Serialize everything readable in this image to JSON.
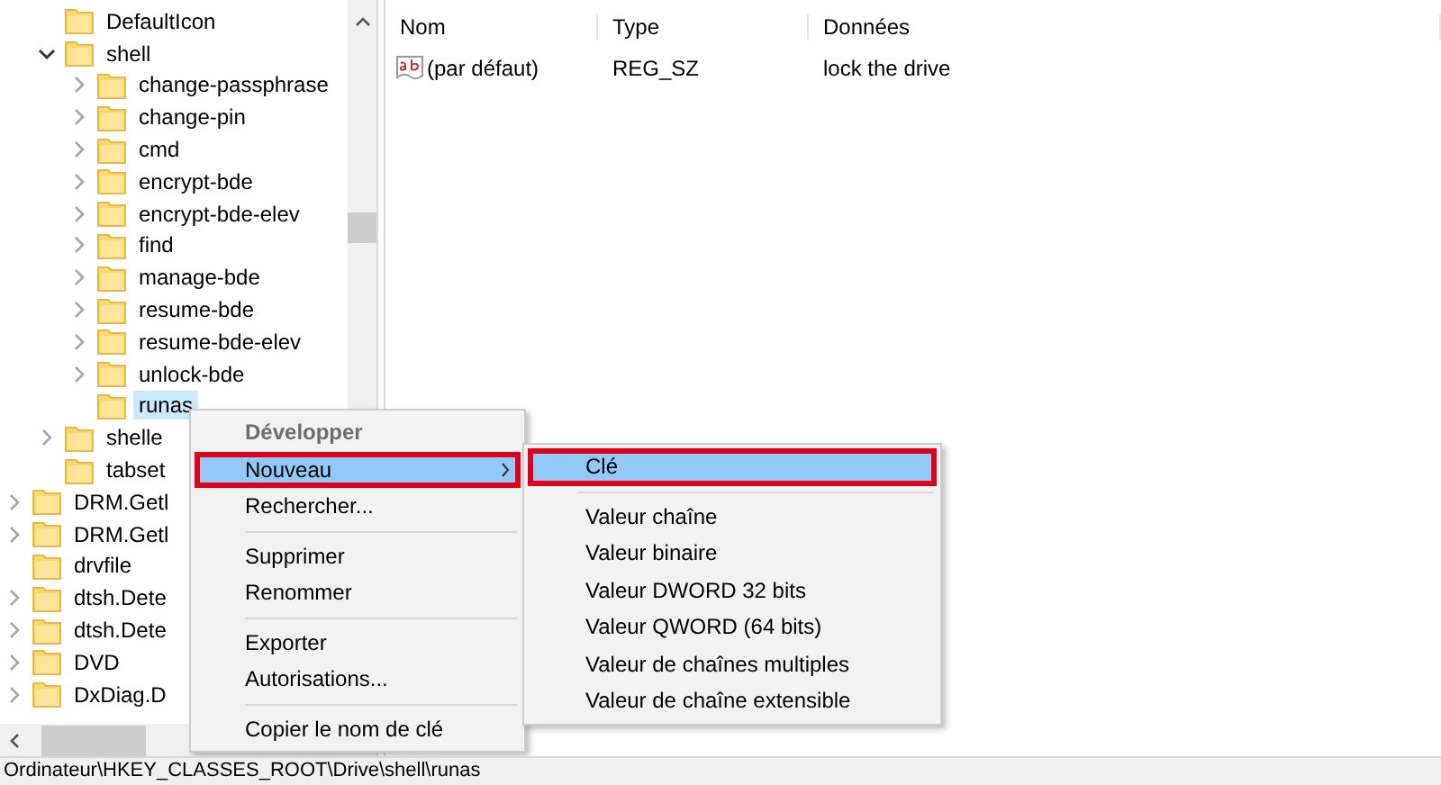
{
  "tree": {
    "nested_items": [
      {
        "label": "DefaultIcon",
        "selected": false
      },
      {
        "label": "shell",
        "expanded": true,
        "selected": false,
        "children": [
          {
            "label": "change-passphrase",
            "expanded": false,
            "selected": false
          },
          {
            "label": "change-pin",
            "expanded": false,
            "selected": false
          },
          {
            "label": "cmd",
            "expanded": false,
            "selected": false
          },
          {
            "label": "encrypt-bde",
            "expanded": false,
            "selected": false
          },
          {
            "label": "encrypt-bde-elev",
            "expanded": false,
            "selected": false
          },
          {
            "label": "find",
            "expanded": false,
            "selected": false
          },
          {
            "label": "manage-bde",
            "expanded": false,
            "selected": false
          },
          {
            "label": "resume-bde",
            "expanded": false,
            "selected": false
          },
          {
            "label": "resume-bde-elev",
            "expanded": false,
            "selected": false
          },
          {
            "label": "unlock-bde",
            "expanded": false,
            "selected": false
          },
          {
            "label": "runas",
            "selected": true
          }
        ]
      },
      {
        "label": "shelle",
        "expanded": false,
        "selected": false
      },
      {
        "label": "tabset",
        "selected": false
      }
    ],
    "items": [
      {
        "label": "DRM.Getl",
        "expanded": false,
        "selected": false
      },
      {
        "label": "DRM.Getl",
        "expanded": false,
        "selected": false
      },
      {
        "label": "drvfile",
        "selected": false
      },
      {
        "label": "dtsh.Dete",
        "expanded": false,
        "selected": false
      },
      {
        "label": "dtsh.Dete",
        "expanded": false,
        "selected": false
      },
      {
        "label": "DVD",
        "expanded": false,
        "selected": false
      },
      {
        "label": "DxDiag.D",
        "expanded": false,
        "selected": false
      }
    ]
  },
  "values_table": {
    "columns": [
      "Nom",
      "Type",
      "Données"
    ],
    "rows": [
      {
        "name": "(par défaut)",
        "type": "REG_SZ",
        "data": "lock the drive"
      }
    ]
  },
  "context_menu": {
    "items": [
      {
        "kind": "item",
        "label": "Développer",
        "disabled": true,
        "selected": false,
        "outlined": false,
        "submenu": false
      },
      {
        "kind": "item",
        "label": "Nouveau",
        "disabled": false,
        "selected": true,
        "outlined": true,
        "submenu": true
      },
      {
        "kind": "item",
        "label": "Rechercher...",
        "disabled": false,
        "selected": false,
        "outlined": false,
        "submenu": false
      },
      {
        "kind": "separator"
      },
      {
        "kind": "item",
        "label": "Supprimer",
        "disabled": false,
        "selected": false,
        "outlined": false,
        "submenu": false
      },
      {
        "kind": "item",
        "label": "Renommer",
        "disabled": false,
        "selected": false,
        "outlined": false,
        "submenu": false
      },
      {
        "kind": "separator"
      },
      {
        "kind": "item",
        "label": "Exporter",
        "disabled": false,
        "selected": false,
        "outlined": false,
        "submenu": false
      },
      {
        "kind": "item",
        "label": "Autorisations...",
        "disabled": false,
        "selected": false,
        "outlined": false,
        "submenu": false
      },
      {
        "kind": "separator"
      },
      {
        "kind": "item",
        "label": "Copier le nom de clé",
        "disabled": false,
        "selected": false,
        "outlined": false,
        "submenu": false
      }
    ]
  },
  "submenu": {
    "items": [
      {
        "kind": "item",
        "label": "Clé",
        "selected": true,
        "outlined": true
      },
      {
        "kind": "separator"
      },
      {
        "kind": "item",
        "label": "Valeur chaîne",
        "selected": false,
        "outlined": false
      },
      {
        "kind": "item",
        "label": "Valeur binaire",
        "selected": false,
        "outlined": false
      },
      {
        "kind": "item",
        "label": "Valeur DWORD 32 bits",
        "selected": false,
        "outlined": false
      },
      {
        "kind": "item",
        "label": "Valeur QWORD (64 bits)",
        "selected": false,
        "outlined": false
      },
      {
        "kind": "item",
        "label": "Valeur de chaînes multiples",
        "selected": false,
        "outlined": false
      },
      {
        "kind": "item",
        "label": "Valeur de chaîne extensible",
        "selected": false,
        "outlined": false
      }
    ]
  },
  "status_bar": {
    "path": "Ordinateur\\HKEY_CLASSES_ROOT\\Drive\\shell\\runas"
  }
}
